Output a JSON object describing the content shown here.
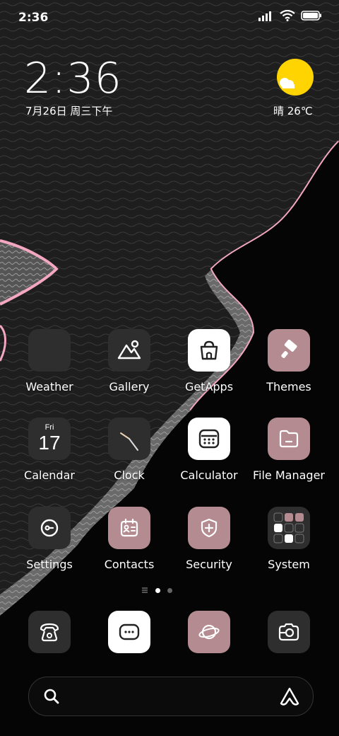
{
  "status_bar": {
    "time": "2:36"
  },
  "clock_widget": {
    "time": "2:36",
    "date": "7月26日 周三下午"
  },
  "weather_widget": {
    "text": "晴 26℃",
    "icon": "sun-cloud-icon"
  },
  "apps": [
    {
      "label": "Weather",
      "icon": "weather-icon"
    },
    {
      "label": "Gallery",
      "icon": "gallery-icon"
    },
    {
      "label": "GetApps",
      "icon": "getapps-icon"
    },
    {
      "label": "Themes",
      "icon": "themes-icon"
    },
    {
      "label": "Calendar",
      "icon": "calendar-icon",
      "day": "Fri",
      "date": "17"
    },
    {
      "label": "Clock",
      "icon": "clock-icon"
    },
    {
      "label": "Calculator",
      "icon": "calculator-icon"
    },
    {
      "label": "File Manager",
      "icon": "file-manager-icon"
    },
    {
      "label": "Settings",
      "icon": "settings-icon"
    },
    {
      "label": "Contacts",
      "icon": "contacts-icon"
    },
    {
      "label": "Security",
      "icon": "security-icon"
    },
    {
      "label": "System",
      "icon": "system-folder-icon"
    }
  ],
  "dock": [
    {
      "icon": "phone-icon"
    },
    {
      "icon": "messages-icon"
    },
    {
      "icon": "browser-icon"
    },
    {
      "icon": "camera-icon"
    }
  ],
  "search_bar": {
    "icon": "search-icon",
    "assistant_icon": "assistant-icon"
  },
  "colors": {
    "accent_pink": "#b48b91",
    "sun": "#ffd400",
    "wave_edge": "#f4a7c0"
  }
}
